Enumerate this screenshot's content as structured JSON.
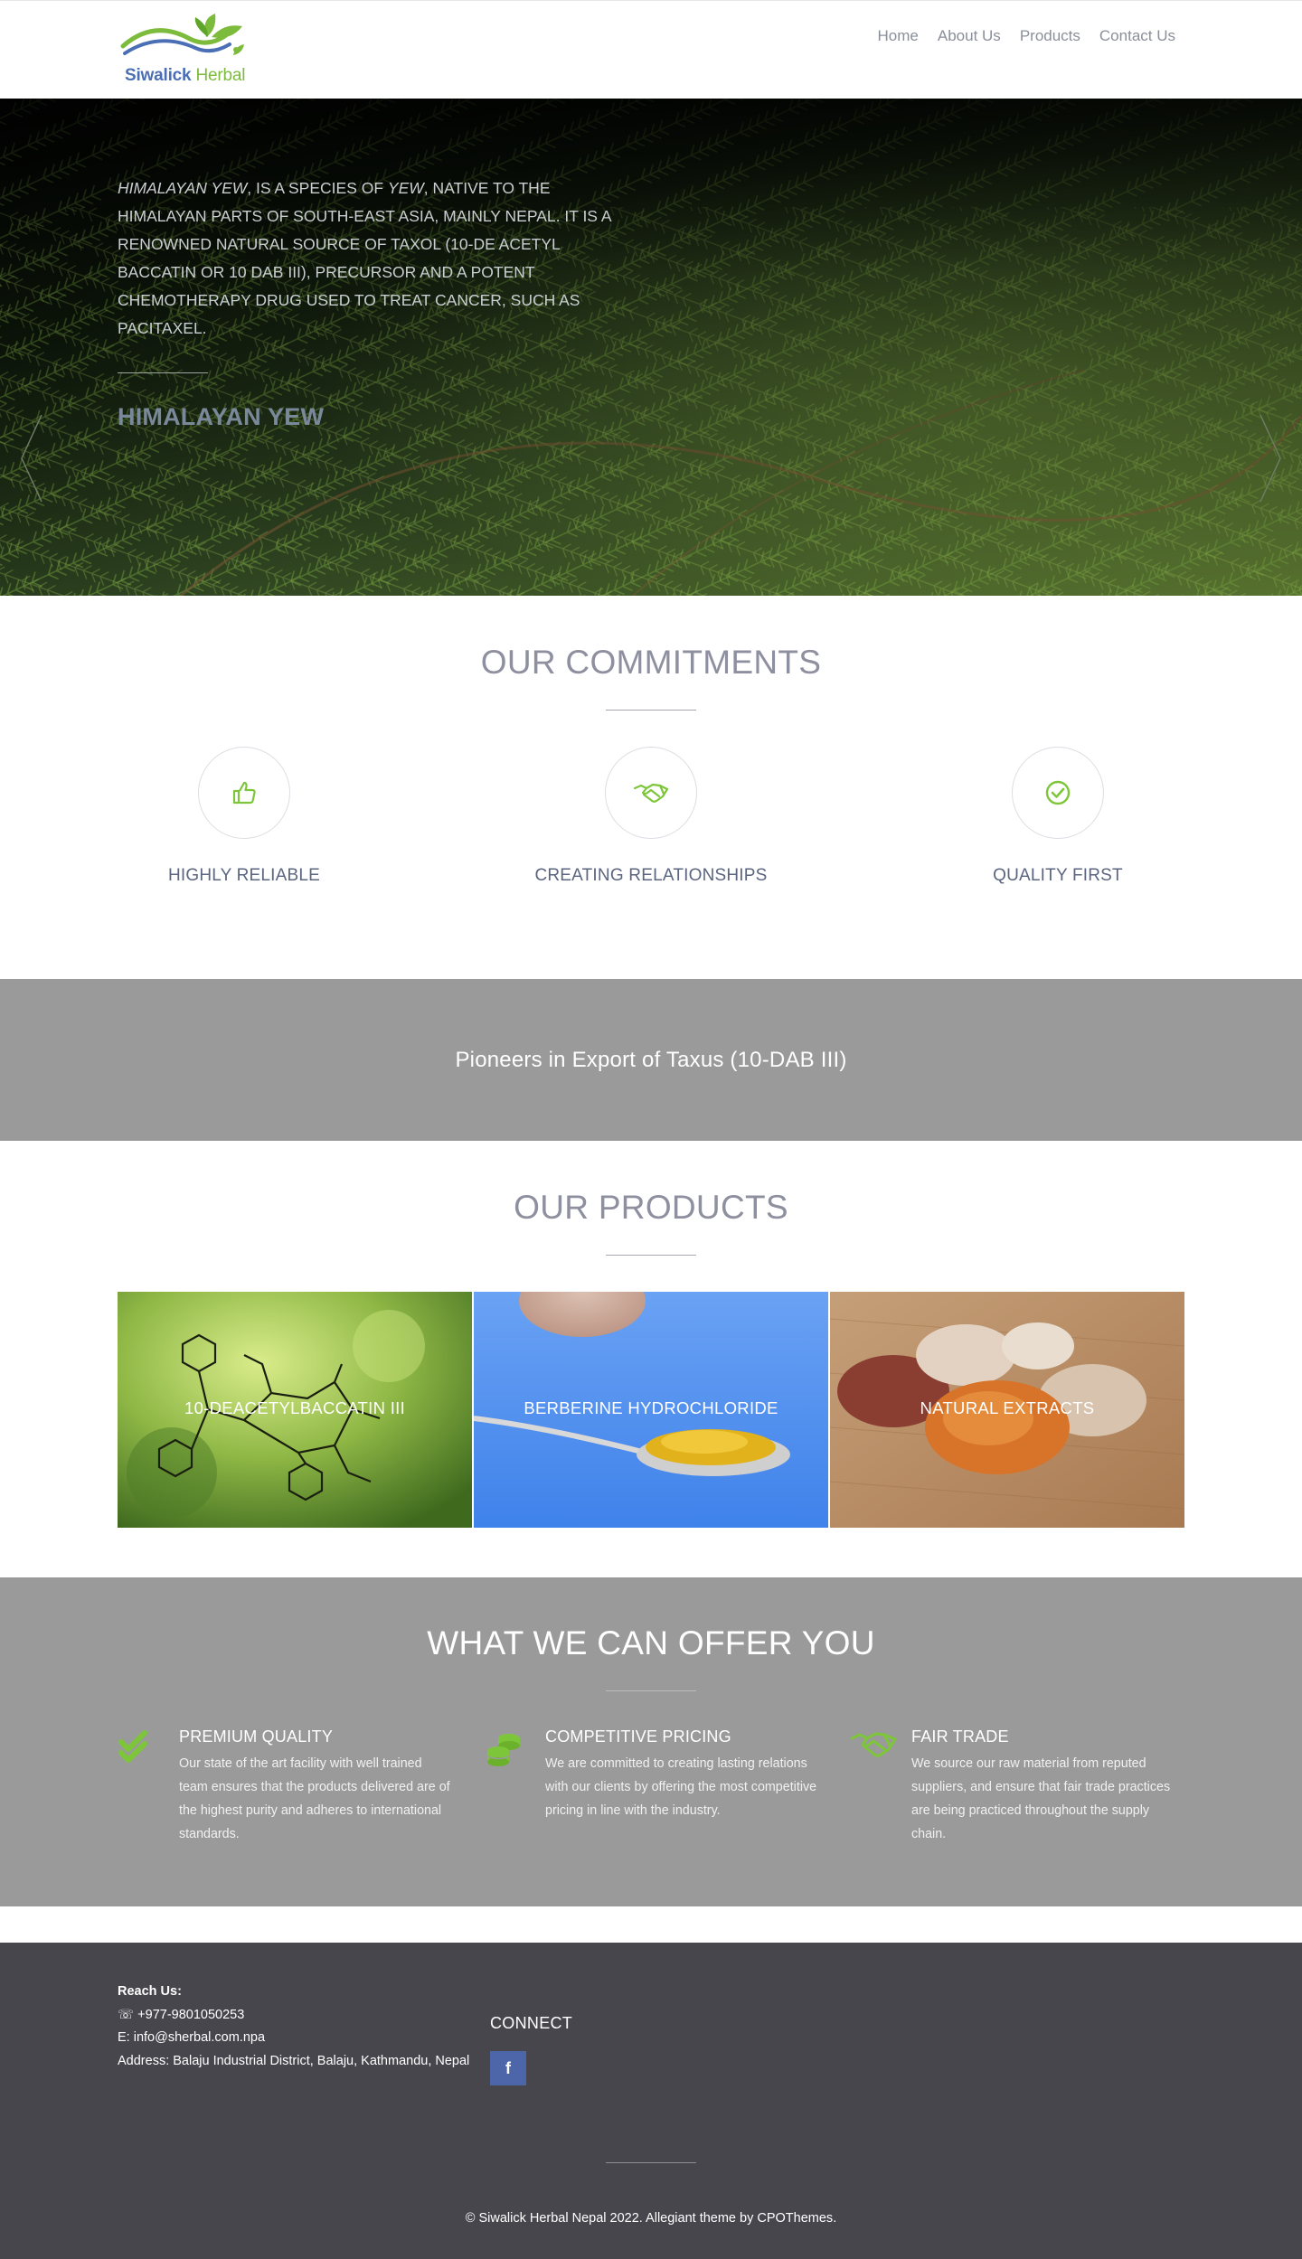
{
  "brand": {
    "name_part1": "Siwalick",
    "name_part2": "Herbal"
  },
  "nav": [
    "Home",
    "About Us",
    "Products",
    "Contact Us"
  ],
  "hero": {
    "text_em1": "HIMALAYAN YEW",
    "text_1": ", IS A SPECIES OF ",
    "text_em2": "YEW",
    "text_2": ", NATIVE TO THE HIMALAYAN PARTS OF SOUTH-EAST ASIA, MAINLY NEPAL. IT IS A RENOWNED NATURAL SOURCE OF TAXOL (10-DE ACETYL BACCATIN OR 10 DAB III), PRECURSOR AND A POTENT CHEMOTHERAPY DRUG USED TO TREAT CANCER, SUCH AS PACITAXEL.",
    "title": "HIMALAYAN YEW"
  },
  "commitments": {
    "title": "OUR COMMITMENTS",
    "items": [
      {
        "label": "HIGHLY RELIABLE",
        "icon": "thumbs-up-icon"
      },
      {
        "label": "CREATING RELATIONSHIPS",
        "icon": "handshake-icon"
      },
      {
        "label": "QUALITY FIRST",
        "icon": "check-circle-icon"
      }
    ]
  },
  "banner": {
    "text": "Pioneers in Export of Taxus (10-DAB III)"
  },
  "products": {
    "title": "OUR PRODUCTS",
    "items": [
      {
        "label": "10-DEACETYLBACCATIN III"
      },
      {
        "label": "BERBERINE HYDROCHLORIDE"
      },
      {
        "label": "NATURAL EXTRACTS"
      }
    ]
  },
  "offer": {
    "title": "WHAT WE CAN OFFER YOU",
    "items": [
      {
        "title": "PREMIUM QUALITY",
        "desc": "Our state of the art facility with well trained team ensures that the products delivered are of the highest purity and adheres to international standards.",
        "icon": "double-check-icon"
      },
      {
        "title": "COMPETITIVE PRICING",
        "desc": "We are committed to creating lasting relations with our clients by offering the most competitive pricing in line with the industry.",
        "icon": "coins-icon"
      },
      {
        "title": "FAIR TRADE",
        "desc": "We source our raw material from reputed suppliers, and ensure that fair trade practices are being practiced throughout the supply chain.",
        "icon": "handshake-icon"
      }
    ]
  },
  "footer": {
    "reach_title": "Reach Us:",
    "phone": "☏ +977-9801050253",
    "email": "E: info@sherbal.com.npa",
    "address": "Address: Balaju Industrial District, Balaju, Kathmandu, Nepal",
    "connect_title": "CONNECT",
    "facebook_glyph": "f",
    "copyright_text": "© Siwalick Herbal Nepal 2022. Allegiant theme by ",
    "copyright_link": "CPOThemes",
    "copyright_end": "."
  },
  "colors": {
    "accent": "#7dc63a",
    "gray_band": "#9a9a9a",
    "footer_bg": "#47464d",
    "brand_blue": "#4b6fb5",
    "brand_green": "#7dbb3c"
  }
}
